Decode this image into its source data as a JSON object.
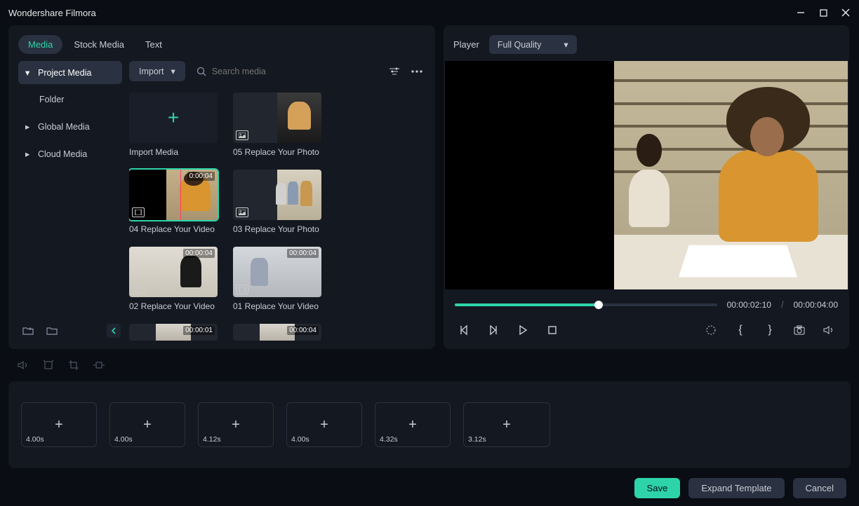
{
  "app": {
    "title": "Wondershare Filmora"
  },
  "tabs": {
    "media": "Media",
    "stock": "Stock Media",
    "text": "Text"
  },
  "sidebar": {
    "project": "Project Media",
    "folder": "Folder",
    "global": "Global Media",
    "cloud": "Cloud Media"
  },
  "toolbar": {
    "import": "Import",
    "search_placeholder": "Search media"
  },
  "media": {
    "import_label": "Import Media",
    "items": [
      {
        "label": "05 Replace Your Photo",
        "type": "photo",
        "duration": ""
      },
      {
        "label": "04 Replace Your Video",
        "type": "video",
        "duration": "0:00:04",
        "selected": true
      },
      {
        "label": "03 Replace Your Photo",
        "type": "photo",
        "duration": ""
      },
      {
        "label": "02 Replace Your Video",
        "type": "video",
        "duration": "00:00:04"
      },
      {
        "label": "01 Replace Your Video",
        "type": "video",
        "duration": "00:00:04"
      },
      {
        "label": "",
        "type": "video",
        "duration": "00:00:01"
      },
      {
        "label": "",
        "type": "video",
        "duration": "00:00:04"
      }
    ]
  },
  "player": {
    "label": "Player",
    "quality": "Full Quality",
    "current_time": "00:00:02:10",
    "total_time": "00:00:04:00",
    "progress_pct": 55
  },
  "timeline": {
    "slots": [
      {
        "duration": "4.00s"
      },
      {
        "duration": "4.00s"
      },
      {
        "duration": "4.12s"
      },
      {
        "duration": "4.00s"
      },
      {
        "duration": "4.32s"
      },
      {
        "duration": "3.12s",
        "wide": true
      }
    ]
  },
  "footer": {
    "save": "Save",
    "expand": "Expand Template",
    "cancel": "Cancel"
  }
}
